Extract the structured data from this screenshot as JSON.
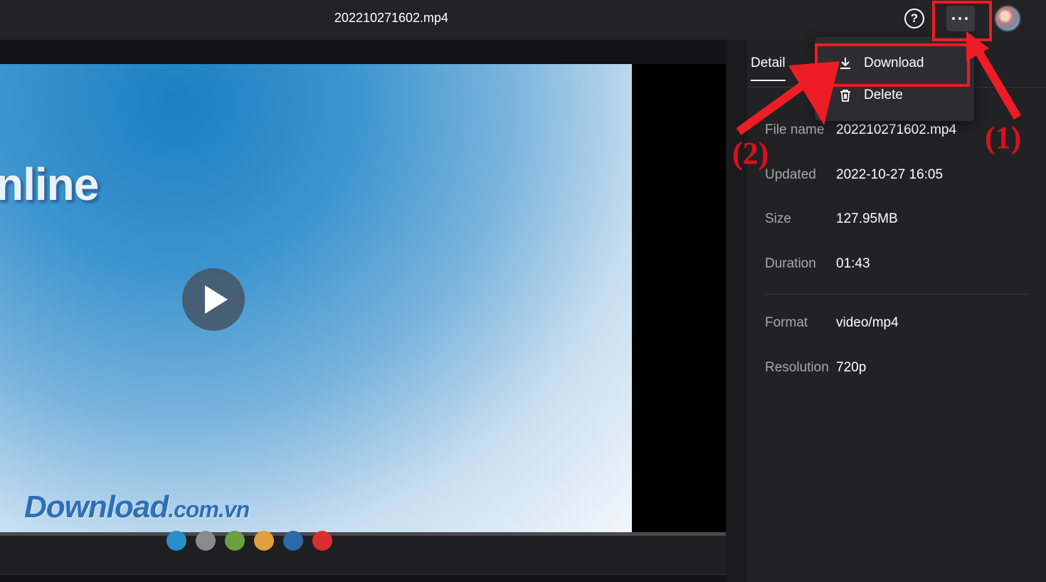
{
  "header": {
    "title": "202210271602.mp4",
    "help_icon": "question-circle-icon",
    "more_icon": "ellipsis-icon"
  },
  "video": {
    "overlay_text": "nline",
    "watermark_main": "Download",
    "watermark_domain": ".com.vn",
    "play_icon": "play-icon",
    "dot_colors": [
      "#2a8fc9",
      "#8a8a8a",
      "#6aa040",
      "#e0a040",
      "#2a6aa8",
      "#d83030"
    ]
  },
  "menu": {
    "download_label": "Download",
    "delete_label": "Delete"
  },
  "sidebar": {
    "tab_label": "Detail",
    "details": [
      {
        "label": "File name",
        "value": "202210271602.mp4"
      },
      {
        "label": "Updated",
        "value": "2022-10-27 16:05"
      },
      {
        "label": "Size",
        "value": "127.95MB"
      },
      {
        "label": "Duration",
        "value": "01:43"
      },
      {
        "label": "Format",
        "value": "video/mp4"
      },
      {
        "label": "Resolution",
        "value": "720p"
      }
    ]
  },
  "annotations": {
    "step1": "(1)",
    "step2": "(2)",
    "color": "#ee1c24"
  }
}
